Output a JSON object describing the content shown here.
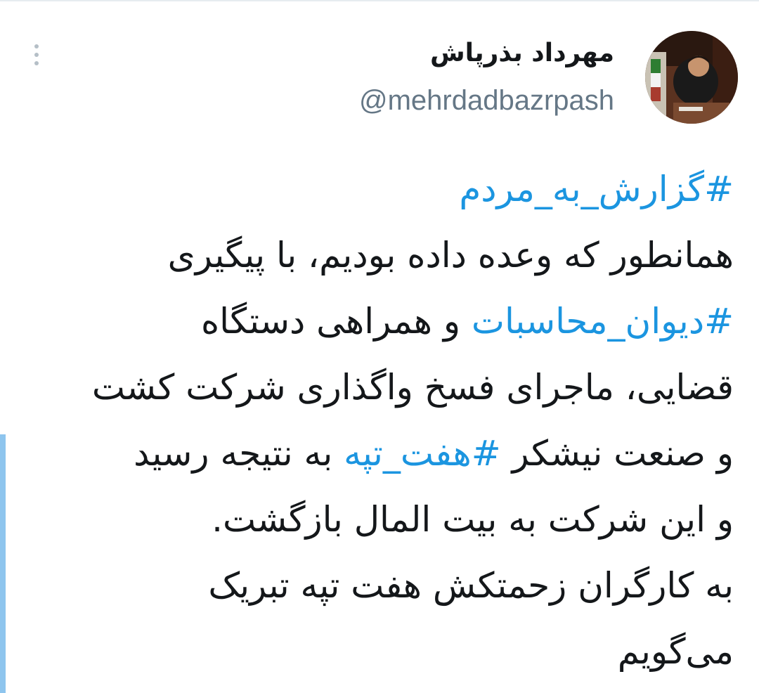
{
  "user": {
    "display_name": "مهرداد بذرپاش",
    "handle": "@mehrdadbazrpash"
  },
  "menu": {
    "icon": "more-vertical-icon"
  },
  "avatar": {
    "icon": "profile-photo"
  },
  "tweet": {
    "lines": [
      {
        "parts": [
          {
            "text": "#گزارش_به_مردم",
            "hashtag": true
          }
        ]
      },
      {
        "parts": [
          {
            "text": "همانطور که وعده داده بودیم، با پیگیری",
            "hashtag": false
          }
        ]
      },
      {
        "parts": [
          {
            "text": "#دیوان_محاسبات",
            "hashtag": true
          },
          {
            "text": " و همراهی دستگاه",
            "hashtag": false
          }
        ]
      },
      {
        "parts": [
          {
            "text": "قضایی، ماجرای فسخ واگذاری شرکت کشت",
            "hashtag": false
          }
        ]
      },
      {
        "parts": [
          {
            "text": "و صنعت نیشکر ",
            "hashtag": false
          },
          {
            "text": "#هفت_تپه",
            "hashtag": true
          },
          {
            "text": " به نتیجه رسید",
            "hashtag": false
          }
        ]
      },
      {
        "parts": [
          {
            "text": "و این شرکت به بیت المال بازگشت.",
            "hashtag": false
          }
        ]
      },
      {
        "parts": [
          {
            "text": "به کارگران زحمتکش هفت تپه تبریک",
            "hashtag": false
          }
        ]
      },
      {
        "parts": [
          {
            "text": "می‌گویم",
            "hashtag": false
          }
        ]
      }
    ]
  },
  "colors": {
    "hashtag": "#1b95e0",
    "text": "#14171a",
    "handle": "#657786",
    "accent_bar": "#8ec5ee"
  }
}
